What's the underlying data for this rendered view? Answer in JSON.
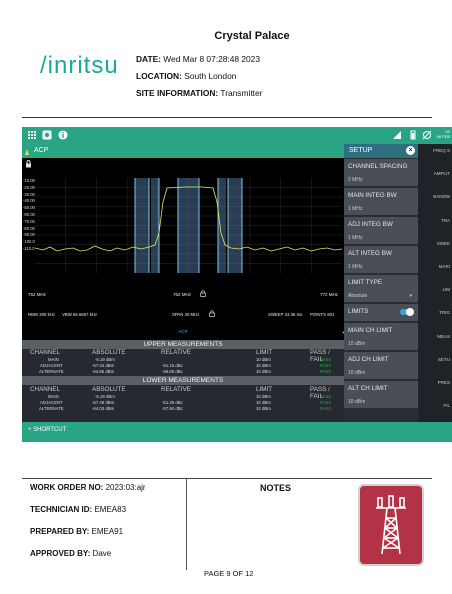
{
  "header": {
    "logo_text": "/inritsu",
    "title": "Crystal Palace",
    "date_label": "DATE:",
    "date_value": "Wed Mar 8 07:28:48 2023",
    "location_label": "LOCATION:",
    "location_value": "South London",
    "site_label": "SITE INFORMATION:",
    "site_value": "Transmitter"
  },
  "screen": {
    "topbar": {
      "menu_icon": "menu-icon",
      "camera_icon": "camera-icon",
      "info_icon": "info-icon",
      "time": "03",
      "date": "08 FEB"
    },
    "panel_title": "ACP",
    "y_ticks": [
      "-10.00",
      "-20.00",
      "-30.00",
      "-40.00",
      "-50.00",
      "-60.00",
      "-70.00",
      "-80.00",
      "-90.00",
      "-100.0",
      "-110.0"
    ],
    "x_left": "752 MHz",
    "x_center": "762 MHz",
    "x_right": "772 MHz",
    "rbw": "RBW 200 kHz",
    "vbw": "VBW 66.6667 kHz",
    "span": "SPAN 20 MHz",
    "sweep": "SWEEP 23.36 ms",
    "points": "POINTS 601",
    "dropdown_label": "ACP",
    "upper_title": "UPPER MEASUREMENTS",
    "lower_title": "LOWER MEASUREMENTS",
    "columns": [
      "CHANNEL",
      "ABSOLUTE",
      "RELATIVE",
      "LIMIT",
      "PASS / FAIL"
    ],
    "upper_rows": [
      {
        "channel": "MAIN",
        "absolute": "-6.19 dBm",
        "relative": "",
        "limit": "10 dBm",
        "status": "PASS"
      },
      {
        "channel": "ADJACENT",
        "absolute": "-57.34 dBm",
        "relative": "-51.15 dBc",
        "limit": "10 dBm",
        "status": "PASS"
      },
      {
        "channel": "ALTERNATE",
        "absolute": "-64.85 dBm",
        "relative": "-58.65 dBc",
        "limit": "10 dBm",
        "status": "PASS"
      }
    ],
    "lower_rows": [
      {
        "channel": "MAIN",
        "absolute": "-6.19 dBm",
        "relative": "",
        "limit": "10 dBm",
        "status": "PASS"
      },
      {
        "channel": "ADJACENT",
        "absolute": "-57.48 dBm",
        "relative": "-51.29 dBc",
        "limit": "10 dBm",
        "status": "PASS"
      },
      {
        "channel": "ALTERNATE",
        "absolute": "-64.03 dBm",
        "relative": "-57.84 dBc",
        "limit": "10 dBm",
        "status": "PASS"
      }
    ],
    "shortcut": "+ SHORTCUT",
    "setup": {
      "title": "SETUP",
      "items": [
        {
          "name": "CHANNEL SPACING",
          "value": "2 MHz"
        },
        {
          "name": "MAIN INTEG BW",
          "value": "1 MHz"
        },
        {
          "name": "ADJ INTEG BW",
          "value": "1 MHz"
        },
        {
          "name": "ALT INTEG BW",
          "value": "1 MHz"
        },
        {
          "name": "LIMIT TYPE",
          "value": "Absolute"
        },
        {
          "name": "LIMITS",
          "value": ""
        },
        {
          "name": "MAIN CH LIMIT",
          "value": "10 dBm"
        },
        {
          "name": "ADJ CH LIMIT",
          "value": "10 dBm"
        },
        {
          "name": "ALT CH LIMIT",
          "value": "10 dBm"
        }
      ]
    },
    "side_menu": [
      "FREQ S",
      "AMPLIT",
      "BANDW",
      "TRA",
      "SWEE",
      "MARI",
      "LIM",
      "TRIG",
      "MEAS",
      "SETU",
      "PRES",
      "FIL"
    ]
  },
  "footer": {
    "work_order_label": "WORK ORDER NO:",
    "work_order_value": "2023:03:ajr",
    "technician_label": "TECHNICIAN ID:",
    "technician_value": "EMEA83",
    "prepared_label": "PREPARED BY:",
    "prepared_value": "EMEA91",
    "approved_label": "APPROVED BY:",
    "approved_value": "Dave",
    "notes": "NOTES",
    "page": "PAGE 9 OF 12",
    "image_icon": "cell-tower-icon"
  },
  "colors": {
    "brand": "#1aa89a",
    "accent": "#2aa584",
    "pass": "#2fa84f",
    "tile": "#b33245"
  }
}
